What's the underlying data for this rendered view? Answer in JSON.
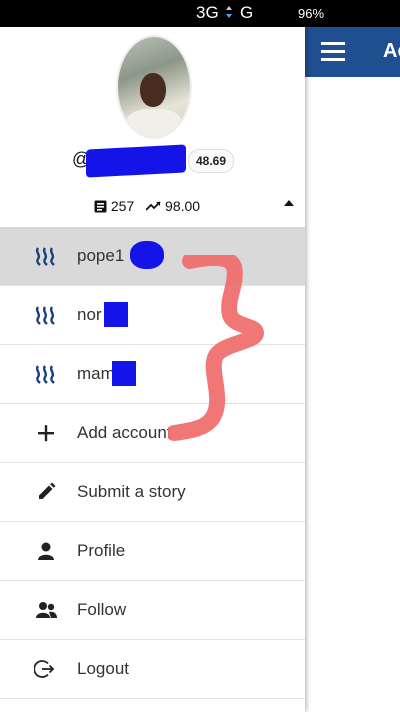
{
  "status_bar": {
    "network": "3G",
    "network2": "G",
    "battery": "96%"
  },
  "app_bar": {
    "title": "Ac",
    "color": "#1f4e91"
  },
  "profile": {
    "at_prefix": "@",
    "reputation": "48.69",
    "posts_count": "257",
    "voting_power": "98.00"
  },
  "accounts": [
    {
      "label": "pope1"
    },
    {
      "label": "nor"
    },
    {
      "label": "mam"
    }
  ],
  "menu": {
    "add_account": "Add account",
    "submit_story": "Submit a story",
    "profile": "Profile",
    "follow": "Follow",
    "logout": "Logout"
  },
  "colors": {
    "redaction": "#1414e8",
    "annotation": "#f07070",
    "steem_icon": "#1a3f7a"
  }
}
